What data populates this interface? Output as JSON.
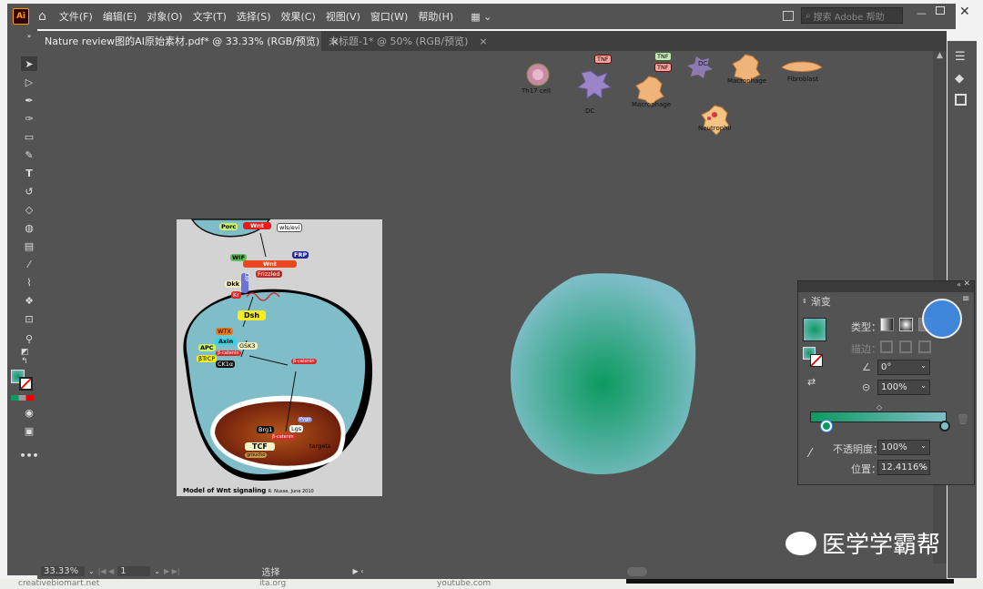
{
  "app": {
    "logo": "Ai"
  },
  "menu": [
    "文件(F)",
    "编辑(E)",
    "对象(O)",
    "文字(T)",
    "选择(S)",
    "效果(C)",
    "视图(V)",
    "窗口(W)",
    "帮助(H)"
  ],
  "search": {
    "placeholder": "搜索 Adobe 帮助"
  },
  "tabs": [
    {
      "label": "Nature review图的AI原始素材.pdf* @ 33.33% (RGB/预览)",
      "close": "×"
    },
    {
      "label": "未标题-1* @ 50% (RGB/预览)",
      "close": "×"
    }
  ],
  "cells": {
    "th17": "Th17 cell",
    "dc1": "DC",
    "dc2": "DC",
    "macrophage1": "Macrophage",
    "macrophage2": "Macrophage",
    "fibroblast": "Fibroblast",
    "neutrophil": "Neutrophil",
    "tnf1": "TNF",
    "tnf2": "TNF",
    "tnf3": "TNF"
  },
  "wnt": {
    "porc": "Porc",
    "wnt_top": "Wnt",
    "wls": "wls/evi",
    "wif": "WIF",
    "wnt": "Wnt",
    "frp": "FRP",
    "frizzled": "Frizzled",
    "dkk": "Dkk",
    "lrp": "LRP",
    "kr": "Kr",
    "dsh": "Dsh",
    "wtx": "WTX",
    "axin": "Axin",
    "apc": "APC",
    "gsk3": "GSK3",
    "btrcp": "βTrCP",
    "ck1a": "CK1α",
    "bcat1": "β-catenin",
    "bcat2": "β-catenin",
    "bcat3": "β-catenin",
    "brg1": "Brg1",
    "pygo": "Pygo",
    "lgs": "Lgs",
    "tcf": "TCF",
    "groucho": "groucho",
    "targets": "targets",
    "title": "Model of Wnt signaling",
    "credit": "R. Nusse, June 2010"
  },
  "gradient_panel": {
    "title": "渐变",
    "type_label": "类型：",
    "stroke_label": "描边：",
    "angle": "0°",
    "aspect": "100%",
    "opacity_label": "不透明度：",
    "opacity": "100%",
    "location_label": "位置：",
    "location": "12.4116%",
    "colors": {
      "start": "#0c9a60",
      "end": "#7fbec8"
    }
  },
  "status": {
    "zoom": "33.33%",
    "page": "1",
    "mode": "选择"
  },
  "watermark": "医学学霸帮",
  "bottom_text": [
    "creativebiomart.net",
    "ita.org",
    "youtube.com"
  ]
}
